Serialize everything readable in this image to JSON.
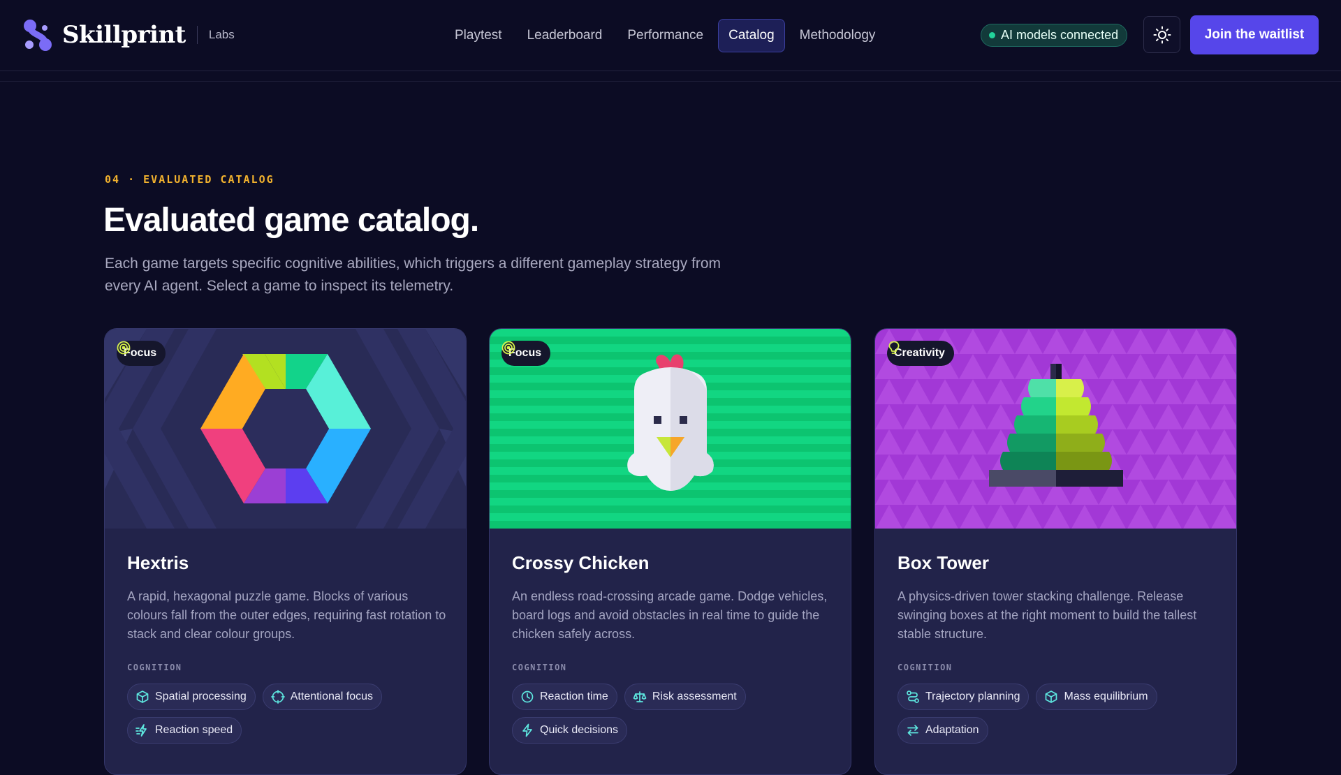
{
  "brand": {
    "name": "Skillprint",
    "tag": "Labs"
  },
  "nav": {
    "items": [
      {
        "label": "Playtest",
        "active": false
      },
      {
        "label": "Leaderboard",
        "active": false
      },
      {
        "label": "Performance",
        "active": false
      },
      {
        "label": "Catalog",
        "active": true
      },
      {
        "label": "Methodology",
        "active": false
      }
    ]
  },
  "status": {
    "label": "AI models connected",
    "color": "#22d39a"
  },
  "theme_toggle": {
    "icon": "sun-icon"
  },
  "cta": {
    "label": "Join the waitlist",
    "color": "#5646ea"
  },
  "section": {
    "eyebrow": "04 · EVALUATED CATALOG",
    "title": "Evaluated game catalog.",
    "description": "Each game targets specific cognitive abilities, which triggers a different gameplay strategy from every AI agent. Select a game to inspect its telemetry."
  },
  "cards": [
    {
      "badge": {
        "label": "Focus",
        "icon": "target-icon"
      },
      "title": "Hextris",
      "description": "A rapid, hexagonal puzzle game. Blocks of various colours fall from the outer edges, requiring fast rotation to stack and clear colour groups.",
      "cognition_label": "COGNITION",
      "chips": [
        {
          "label": "Spatial processing",
          "icon": "cube-icon"
        },
        {
          "label": "Attentional focus",
          "icon": "crosshair-icon"
        },
        {
          "label": "Reaction speed",
          "icon": "speed-icon"
        }
      ]
    },
    {
      "badge": {
        "label": "Focus",
        "icon": "target-icon"
      },
      "title": "Crossy Chicken",
      "description": "An endless road-crossing arcade game. Dodge vehicles, board logs and avoid obstacles in real time to guide the chicken safely across.",
      "cognition_label": "COGNITION",
      "chips": [
        {
          "label": "Reaction time",
          "icon": "clock-icon"
        },
        {
          "label": "Risk assessment",
          "icon": "scale-icon"
        },
        {
          "label": "Quick decisions",
          "icon": "lightning-icon"
        }
      ]
    },
    {
      "badge": {
        "label": "Creativity",
        "icon": "lightbulb-icon"
      },
      "title": "Box Tower",
      "description": "A physics-driven tower stacking challenge. Release swinging boxes at the right moment to build the tallest stable structure.",
      "cognition_label": "COGNITION",
      "chips": [
        {
          "label": "Trajectory planning",
          "icon": "route-icon"
        },
        {
          "label": "Mass equilibrium",
          "icon": "cube-icon"
        },
        {
          "label": "Adaptation",
          "icon": "swap-icon"
        }
      ]
    }
  ]
}
